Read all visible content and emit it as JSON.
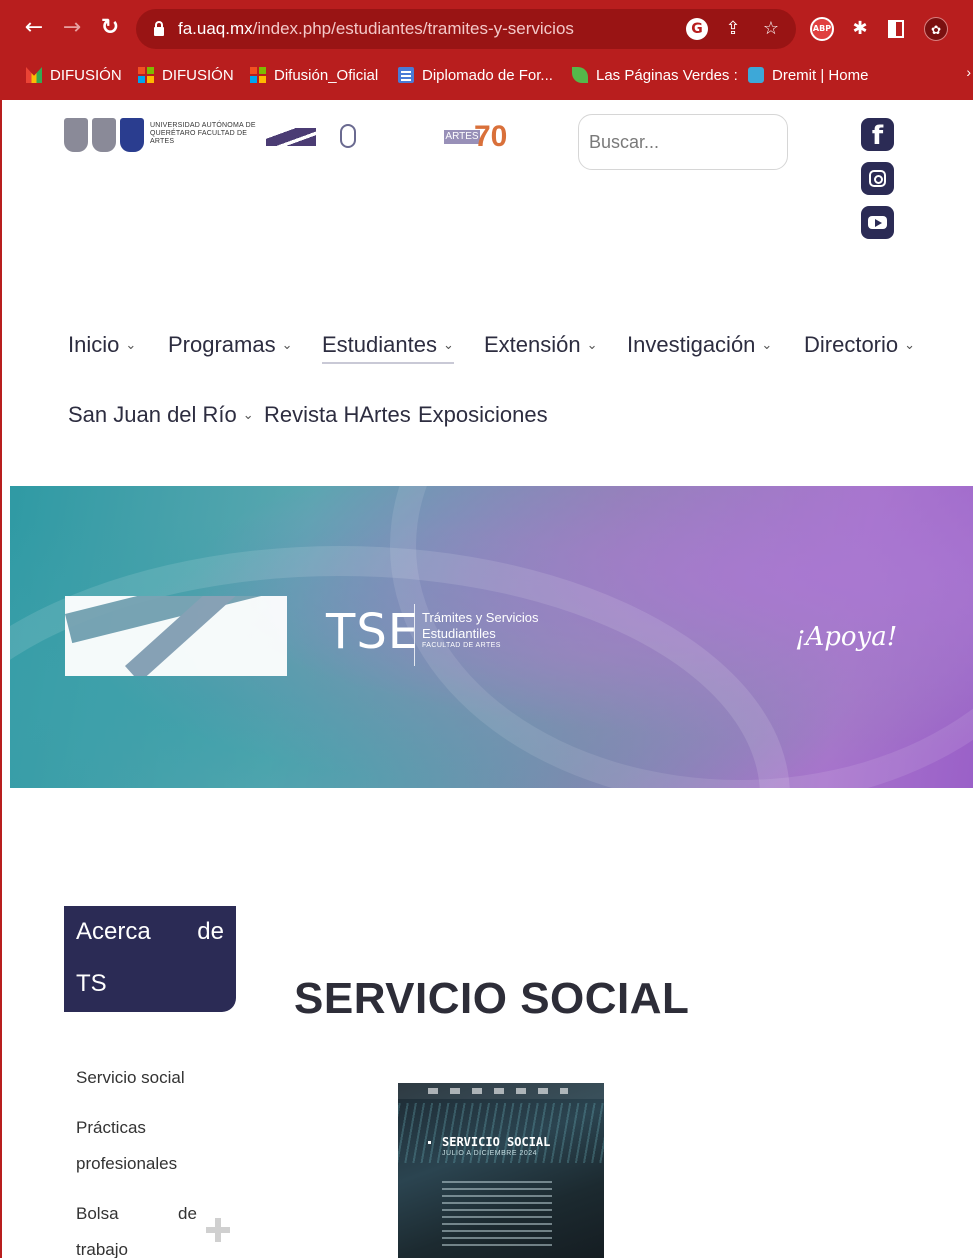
{
  "browser": {
    "url_host": "fa.uaq.mx",
    "url_path": "/index.php/estudiantes/tramites-y-servicios",
    "bookmarks": [
      {
        "label": "DIFUSIÓN",
        "icon": "gmail-icon"
      },
      {
        "label": "DIFUSIÓN",
        "icon": "microsoft-icon"
      },
      {
        "label": "Difusión_Oficial",
        "icon": "microsoft-icon"
      },
      {
        "label": "Diplomado de For...",
        "icon": "doc-icon"
      },
      {
        "label": "Las Páginas Verdes :",
        "icon": "leaf-icon"
      },
      {
        "label": "Dremit | Home",
        "icon": "dremit-icon"
      }
    ],
    "extensions": {
      "abp": "ABP"
    }
  },
  "header": {
    "university_text": "UNIVERSIDAD AUTÓNOMA DE QUERÉTARO FACULTAD DE ARTES",
    "artes_badge": "ARTES",
    "artes_number": "70",
    "search_placeholder": "Buscar..."
  },
  "nav": {
    "items": [
      {
        "label": "Inicio",
        "has_menu": true
      },
      {
        "label": "Programas",
        "has_menu": true
      },
      {
        "label": "Estudiantes",
        "has_menu": true,
        "active": true
      },
      {
        "label": "Extensión",
        "has_menu": true
      },
      {
        "label": "Investigación",
        "has_menu": true
      },
      {
        "label": "Directorio",
        "has_menu": true
      },
      {
        "label": "San Juan del Río",
        "has_menu": true
      },
      {
        "label": "Revista HArtes",
        "has_menu": false
      },
      {
        "label": "Exposiciones",
        "has_menu": false
      }
    ]
  },
  "banner": {
    "acronym": "TSE",
    "subtitle": "Trámites y Servicios Estudiantiles",
    "faculty": "FACULTAD DE ARTES",
    "slogan": "¡Apoya!"
  },
  "sidebar": {
    "heading_line1_a": "Acerca",
    "heading_line1_b": "de",
    "heading_line2": "TS",
    "links": [
      "Servicio social",
      "Prácticas",
      "profesionales",
      "Bolsa",
      "de",
      "trabajo"
    ]
  },
  "main": {
    "title": "SERVICIO SOCIAL",
    "poster_title": "SERVICIO SOCIAL",
    "poster_subtitle": "JULIO A DICIEMBRE 2024"
  },
  "colors": {
    "browser_chrome": "#b81e1e",
    "brand_navy": "#2b2b55",
    "banner_teal": "#2f9aa4",
    "banner_purple": "#a774cc"
  }
}
